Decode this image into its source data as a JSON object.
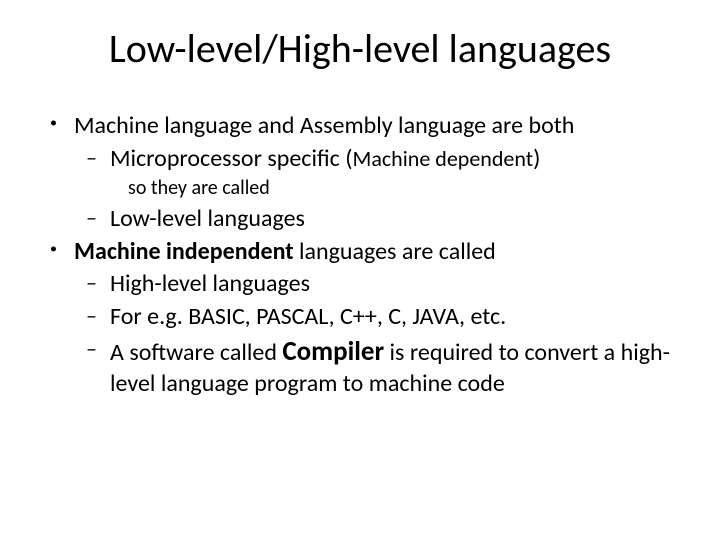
{
  "title": "Low-level/High-level languages",
  "b1": "Machine language and Assembly language are both",
  "b1a_pre": "Microprocessor specific (",
  "b1a_bold": "Machine dependent",
  "b1a_post": ")",
  "b1a_note": "so they are called",
  "b1b": "Low-level languages",
  "b2_bold": "Machine independent",
  "b2_rest": " languages are called",
  "b2a": "High-level languages",
  "b2b": "For e.g. BASIC, PASCAL, C++, C, JAVA, etc.",
  "b2c_pre": "A software called ",
  "b2c_bold": "Compiler",
  "b2c_post": " is required to convert a high-level language program to machine code"
}
